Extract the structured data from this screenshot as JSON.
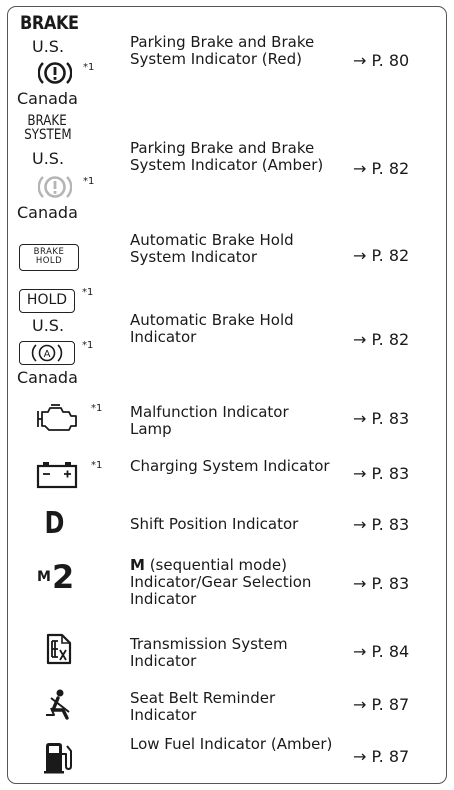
{
  "rows": [
    {
      "icon_labels": [
        "BRAKE",
        "U.S.",
        "*1",
        "Canada"
      ],
      "icon_name": "brake-system-red-icon",
      "description": "Parking Brake and Brake System Indicator (Red)",
      "page_ref": "→ P. 80",
      "color": "#1a1a1a"
    },
    {
      "icon_labels": [
        "BRAKE",
        "SYSTEM",
        "U.S.",
        "*1",
        "Canada"
      ],
      "icon_name": "brake-system-amber-icon",
      "description": "Parking Brake and Brake System Indicator (Amber)",
      "page_ref": "→ P. 82",
      "color": "#b5b5b5"
    },
    {
      "icon_labels": [
        "BRAKE",
        "HOLD"
      ],
      "icon_name": "automatic-brake-hold-system-icon",
      "description": "Automatic Brake Hold System Indicator",
      "page_ref": "→ P. 82"
    },
    {
      "icon_labels": [
        "HOLD",
        "*1",
        "U.S.",
        "*1",
        "Canada"
      ],
      "icon_name": "automatic-brake-hold-icon",
      "description": "Automatic Brake Hold Indicator",
      "page_ref": "→ P. 82"
    },
    {
      "icon_labels": [
        "*1"
      ],
      "icon_name": "engine-malfunction-icon",
      "description": "Malfunction Indicator Lamp",
      "page_ref": "→ P. 83"
    },
    {
      "icon_labels": [
        "*1"
      ],
      "icon_name": "battery-charging-icon",
      "description": "Charging System Indicator",
      "page_ref": "→ P. 83"
    },
    {
      "icon_labels": [
        "D"
      ],
      "icon_name": "shift-position-icon",
      "description": "Shift Position Indicator",
      "page_ref": "→ P. 83"
    },
    {
      "icon_labels": [
        "M",
        "2"
      ],
      "icon_name": "sequential-mode-icon",
      "description_bold": "M",
      "description": " (sequential mode) Indicator/Gear Selection Indicator",
      "page_ref": "→ P. 83"
    },
    {
      "icon_labels": [],
      "icon_name": "transmission-system-icon",
      "description": "Transmission System Indicator",
      "page_ref": "→ P. 84"
    },
    {
      "icon_labels": [],
      "icon_name": "seat-belt-reminder-icon",
      "description": "Seat Belt Reminder Indicator",
      "page_ref": "→ P. 87"
    },
    {
      "icon_labels": [],
      "icon_name": "low-fuel-icon",
      "description": "Low Fuel Indicator (Amber)",
      "page_ref": "→ P. 87"
    }
  ]
}
